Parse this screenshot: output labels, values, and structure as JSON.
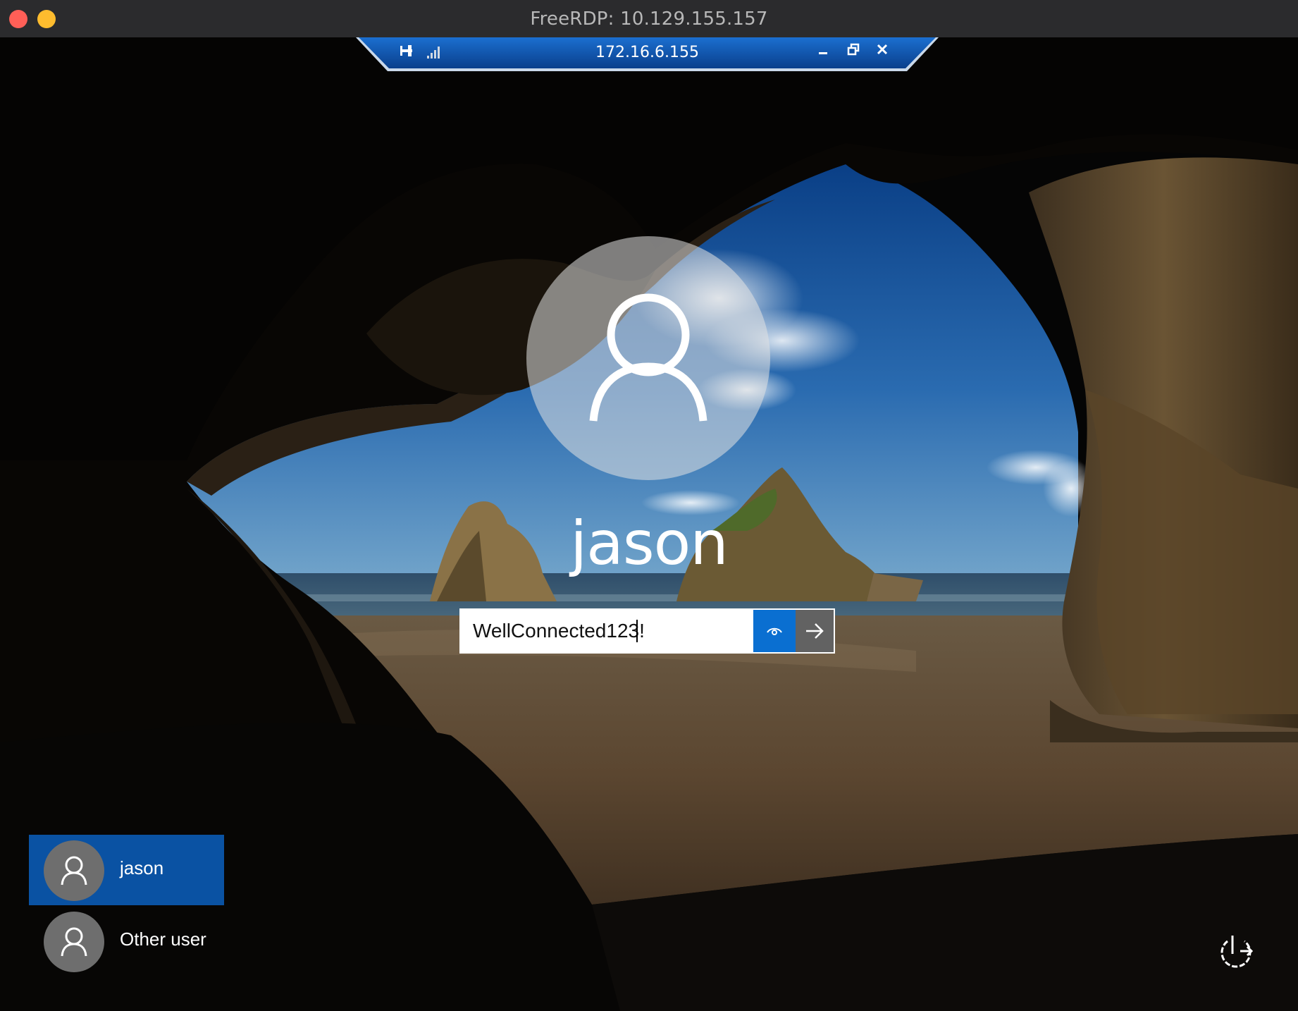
{
  "window": {
    "title": "FreeRDP: 10.129.155.157",
    "traffic_lights": [
      "close",
      "minimize"
    ]
  },
  "rdp_bar": {
    "pin_icon": "pin-icon",
    "signal_icon": "signal-strength-icon",
    "ip": "172.16.6.155",
    "minimize_icon": "minimize-icon",
    "restore_icon": "restore-icon",
    "close_icon": "close-icon",
    "accent": "#1565c0"
  },
  "login": {
    "avatar_icon": "user-icon",
    "username": "jason",
    "password_value": "WellConnected123!",
    "reveal_icon": "eye-icon",
    "submit_icon": "arrow-right-icon",
    "accent": "#0a6fd1"
  },
  "users": [
    {
      "label": "jason",
      "selected": true,
      "icon": "user-icon"
    },
    {
      "label": "Other user",
      "selected": false,
      "icon": "user-icon"
    }
  ],
  "power": {
    "icon": "power-options-icon"
  },
  "colors": {
    "selected_user_bg": "#0a52a3",
    "titlebar_bg": "#2b2b2d"
  }
}
